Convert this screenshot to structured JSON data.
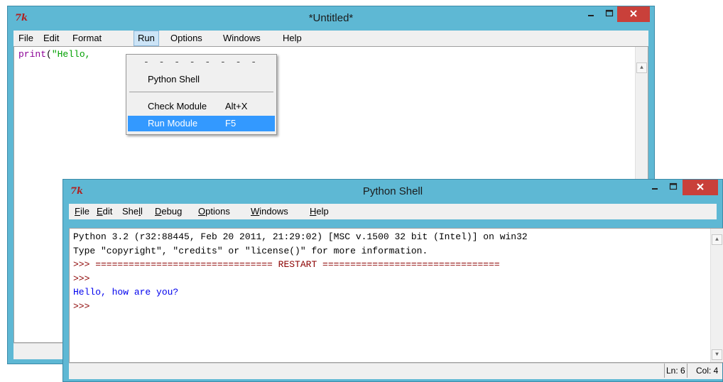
{
  "editor_window": {
    "title": "*Untitled*",
    "logo": "7k",
    "menu": [
      "File",
      "Edit",
      "Format",
      "Run",
      "Options",
      "Windows",
      "Help"
    ],
    "code": {
      "fn": "print",
      "paren": "(",
      "str": "\"Hello,"
    }
  },
  "run_menu": {
    "tearoff": "- - - - - - - - - - - - -",
    "items": [
      {
        "label": "Python Shell",
        "accel": ""
      },
      {
        "label": "Check Module",
        "accel": "Alt+X"
      },
      {
        "label": "Run Module",
        "accel": "F5"
      }
    ]
  },
  "shell_window": {
    "title": "Python Shell",
    "logo": "7k",
    "menu": [
      {
        "first": "F",
        "rest": "ile"
      },
      {
        "first": "E",
        "rest": "dit"
      },
      {
        "pre": "She",
        "u": "l",
        "post": "l"
      },
      {
        "first": "D",
        "rest": "ebug"
      },
      {
        "first": "O",
        "rest": "ptions"
      },
      {
        "first": "W",
        "rest": "indows"
      },
      {
        "first": "H",
        "rest": "elp"
      }
    ],
    "lines": [
      "Python 3.2 (r32:88445, Feb 20 2011, 21:29:02) [MSC v.1500 32 bit (Intel)] on win32",
      "Type \"copyright\", \"credits\" or \"license()\" for more information.",
      ">>> ================================ RESTART ================================",
      ">>>",
      "Hello, how are you?",
      ">>>"
    ],
    "status": {
      "ln": "Ln: 6",
      "col": "Col: 4"
    }
  },
  "colors": {
    "titlebar": "#5eb8d4",
    "close": "#c9403a",
    "highlight": "#3399ff"
  }
}
